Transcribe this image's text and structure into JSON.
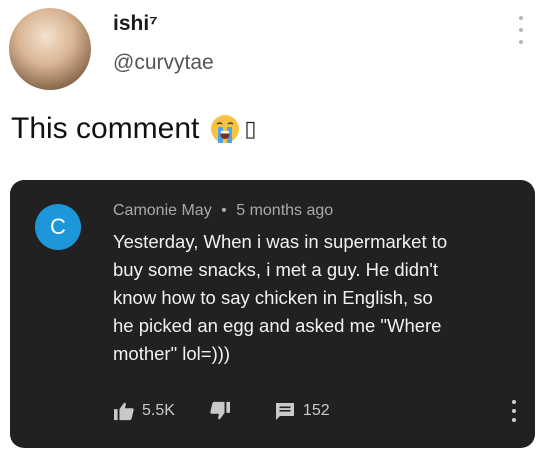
{
  "tweet": {
    "display_name": "ishi⁷",
    "handle": "@curvytae",
    "text": "This comment",
    "emoji": "loudly-crying-face",
    "trailing_glyph": "▯"
  },
  "youtube_comment": {
    "avatar_letter": "C",
    "author": "Camonie May",
    "separator": "•",
    "time": "5 months ago",
    "lines": [
      "Yesterday, When i was in supermarket to",
      "buy some snacks, i met a guy. He didn't",
      "know how to say chicken in English, so",
      "he picked an egg and asked me \"Where",
      "mother\" lol=)))"
    ],
    "likes": "5.5K",
    "replies": "152"
  },
  "colors": {
    "card_bg": "#212121",
    "avatar_blue": "#1d97d9",
    "text_light": "#f1f1f1",
    "meta_gray": "#a9a9a9"
  }
}
